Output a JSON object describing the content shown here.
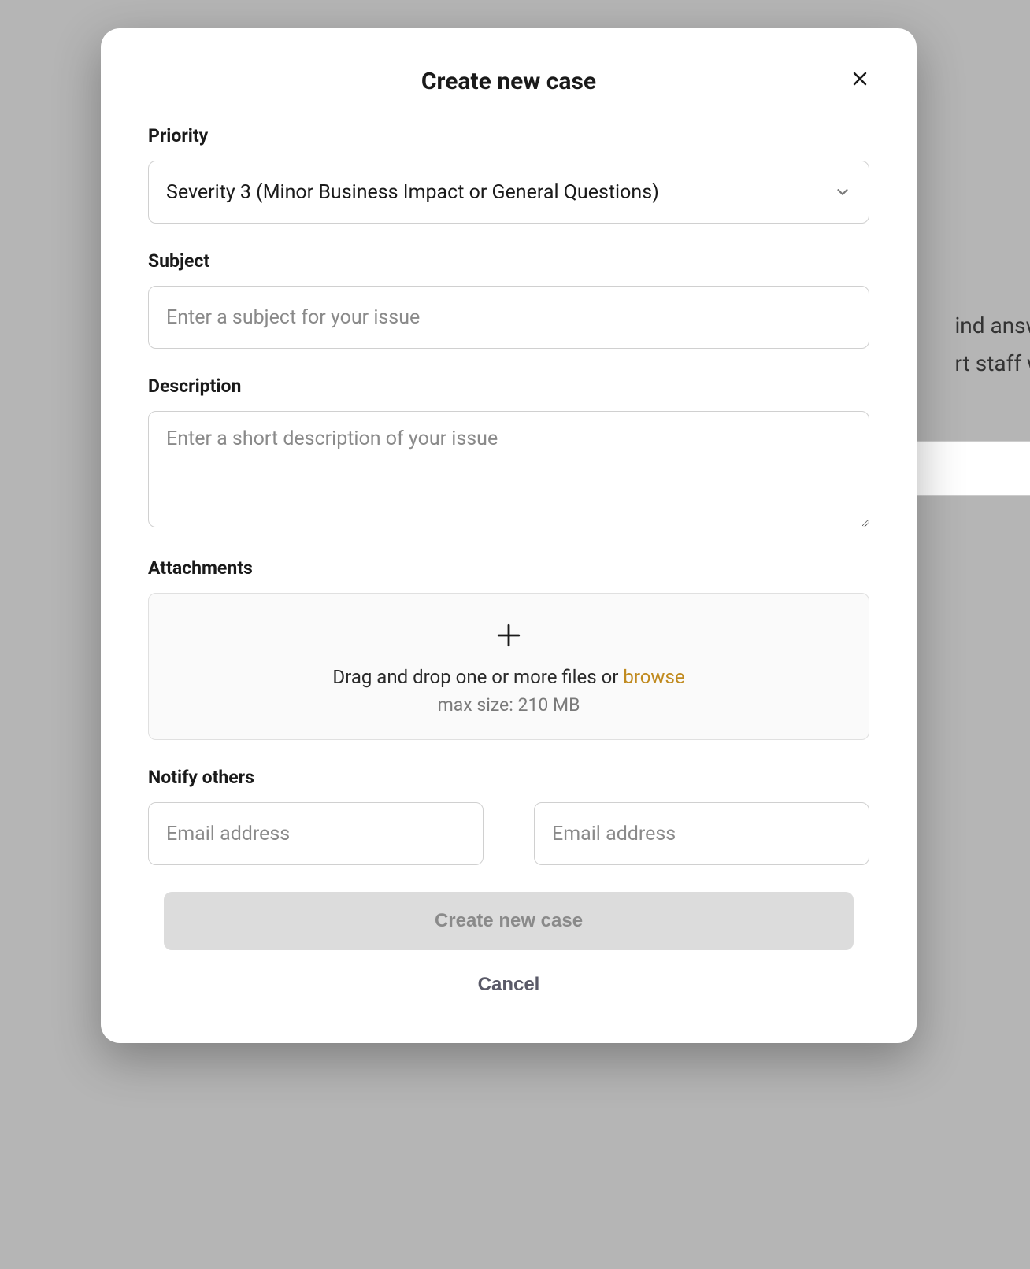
{
  "background": {
    "line1": "ind answer",
    "line2": "rt staff will"
  },
  "modal": {
    "title": "Create new case",
    "priority": {
      "label": "Priority",
      "selected": "Severity 3 (Minor Business Impact or General Questions)"
    },
    "subject": {
      "label": "Subject",
      "placeholder": "Enter a subject for your issue",
      "value": ""
    },
    "description": {
      "label": "Description",
      "placeholder": "Enter a short description of your issue",
      "value": ""
    },
    "attachments": {
      "label": "Attachments",
      "dropText": "Drag and drop one or more files or ",
      "browse": "browse",
      "maxSize": "max size: 210 MB"
    },
    "notify": {
      "label": "Notify others",
      "placeholder1": "Email address",
      "placeholder2": "Email address"
    },
    "submit": "Create new case",
    "cancel": "Cancel"
  }
}
